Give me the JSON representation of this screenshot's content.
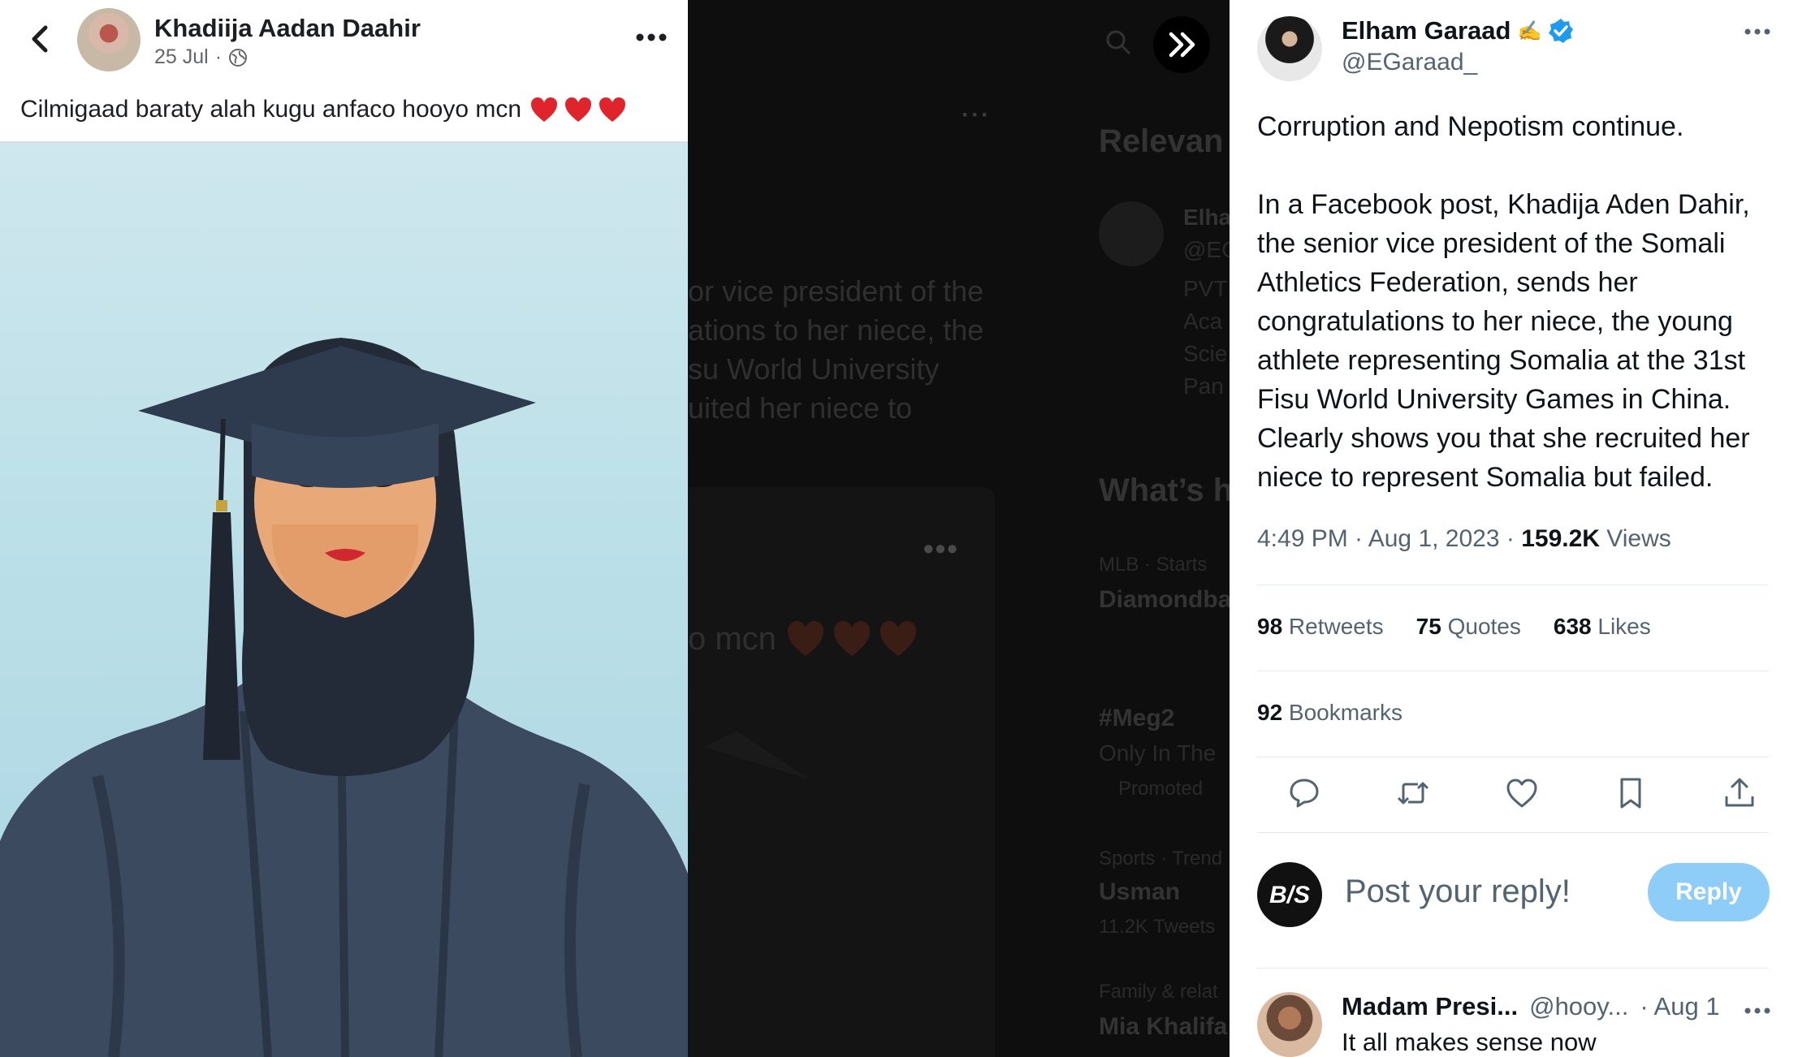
{
  "facebook": {
    "author_name": "Khadiija Aadan Daahir",
    "date": "25 Jul",
    "separator": "·",
    "caption": "Cilmigaad baraty alah kugu anfaco hooyo mcn",
    "heart_count": 3,
    "icons": {
      "back": "chevron-left-icon",
      "privacy": "globe-icon",
      "more": "more-horizontal-icon"
    }
  },
  "background_view": {
    "text_lines": [
      "or vice president of the",
      "ations to her niece, the",
      "su World University",
      "uited her niece to"
    ],
    "caption_fragment": "o mcn",
    "sidebar_heading_1": "Relevan",
    "sidebar_name": "Elha",
    "sidebar_handle": "@EG",
    "sidebar_bio": [
      "PVT",
      "Aca",
      "Scie",
      "Pan"
    ],
    "sidebar_heading_2": "What’s h",
    "trends": [
      {
        "meta": "MLB · Starts",
        "title": "Diamondba"
      },
      {
        "meta": "",
        "title": "#Meg2",
        "sub": "Only In The",
        "promoted": "Promoted"
      },
      {
        "meta": "Sports · Trend",
        "title": "Usman",
        "sub": "11.2K Tweets"
      },
      {
        "meta": "Family & relat",
        "title": "Mia Khalifa"
      }
    ]
  },
  "tweet": {
    "author_name": "Elham Garaad",
    "name_emoji": "✍",
    "handle": "@EGaraad_",
    "body": "Corruption and Nepotism continue.\n\nIn a Facebook post, Khadija Aden Dahir, the senior vice president of the Somali Athletics Federation, sends her congratulations to her niece, the young athlete representing Somalia at the 31st Fisu World University Games in China. Clearly shows you that she recruited her niece to represent Somalia but failed.",
    "time": "4:49 PM · Aug 1, 2023 · ",
    "views_count": "159.2K",
    "views_label": " Views",
    "retweets_count": "98",
    "retweets_label": " Retweets",
    "quotes_count": "75",
    "quotes_label": " Quotes",
    "likes_count": "638",
    "likes_label": " Likes",
    "bookmarks_count": "92",
    "bookmarks_label": " Bookmarks",
    "colors": {
      "verified": "#1d9bf0",
      "reply_button": "#8ecdf8"
    },
    "actions": [
      "reply-icon",
      "retweet-icon",
      "like-icon",
      "bookmark-icon",
      "share-icon"
    ]
  },
  "reply_box": {
    "avatar_text": "B/S",
    "placeholder": "Post your reply!",
    "button_label": "Reply"
  },
  "reply": {
    "name": "Madam Presi...",
    "handle": "@hooy...",
    "date": "· Aug 1",
    "text": "It all makes sense now"
  }
}
